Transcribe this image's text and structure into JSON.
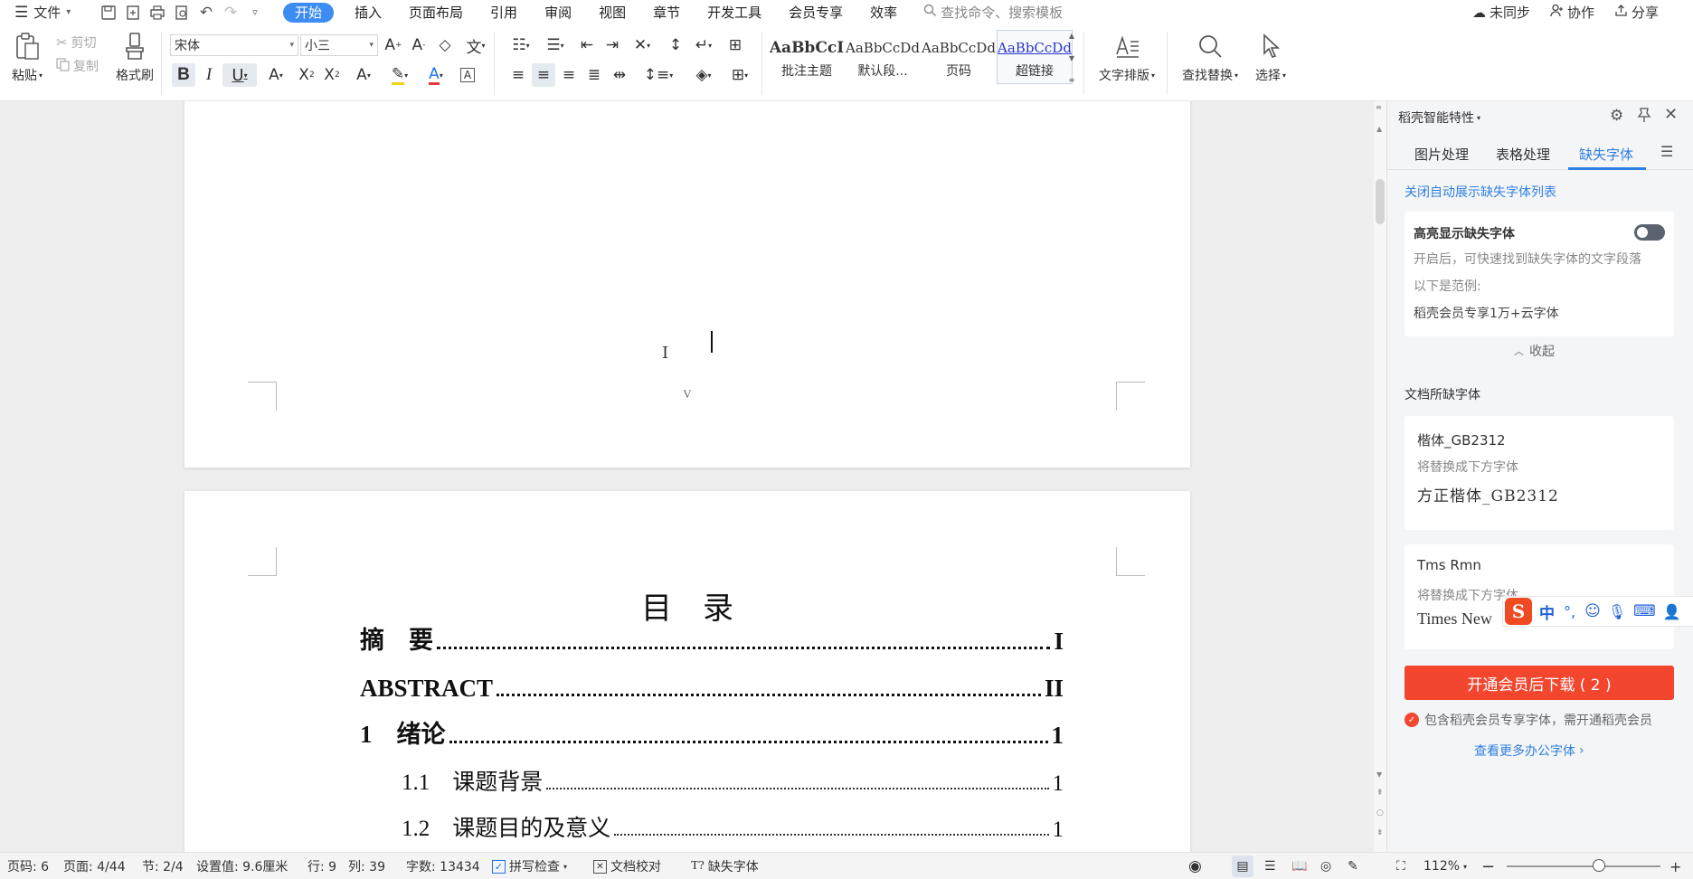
{
  "menubar": {
    "file_label": "文件",
    "tabs": [
      "开始",
      "插入",
      "页面布局",
      "引用",
      "审阅",
      "视图",
      "章节",
      "开发工具",
      "会员专享",
      "效率"
    ],
    "search_placeholder": "查找命令、搜索模板",
    "sync_label": "未同步",
    "collab_label": "协作",
    "share_label": "分享"
  },
  "ribbon": {
    "paste_label": "粘贴",
    "cut_label": "剪切",
    "copy_label": "复制",
    "format_painter_label": "格式刷",
    "font_name": "宋体",
    "font_size": "小三",
    "styles": [
      {
        "preview": "AaBbCcI",
        "label": "批注主题"
      },
      {
        "preview": "AaBbCcDd",
        "label": "默认段..."
      },
      {
        "preview": "AaBbCcDd",
        "label": "页码"
      },
      {
        "preview": "AaBbCcDd",
        "label": "超链接"
      }
    ],
    "text_layout_label": "文字排版",
    "find_replace_label": "查找替换",
    "select_label": "选择"
  },
  "document": {
    "page1_footer": "V",
    "toc_title": "目　录",
    "toc": [
      {
        "title": "摘　要",
        "page": "I",
        "level": 1
      },
      {
        "title": "ABSTRACT",
        "page": "II",
        "level": 1
      },
      {
        "title": "1　绪论",
        "page": "1",
        "level": 1
      },
      {
        "title": "1.1　课题背景",
        "page": "1",
        "level": 2
      },
      {
        "title": "1.2　课题目的及意义",
        "page": "1",
        "level": 2
      }
    ]
  },
  "panel": {
    "title": "稻壳智能特性",
    "tabs": [
      "图片处理",
      "表格处理",
      "缺失字体"
    ],
    "active_tab": 2,
    "close_auto_link": "关闭自动展示缺失字体列表",
    "highlight_title": "高亮显示缺失字体",
    "highlight_on": false,
    "highlight_desc": "开启后，可快速找到缺失字体的文字段落",
    "example_label": "以下是范例:",
    "example_text": "稻壳会员专享1万+云字体",
    "collapse_label": "收起",
    "missing_section_title": "文档所缺字体",
    "missing_fonts": [
      {
        "name": "楷体_GB2312",
        "replace_label": "将替换成下方字体",
        "replacement": "方正楷体_GB2312"
      },
      {
        "name": "Tms Rmn",
        "replace_label": "将替换成下方字体",
        "replacement": "Times New"
      }
    ],
    "ime_label": "中",
    "download_button": "开通会员后下载 ( 2 )",
    "member_note": "包含稻壳会员专享字体，需开通稻壳会员",
    "more_fonts_link": "查看更多办公字体"
  },
  "status": {
    "page_num": "页码: 6",
    "pages": "页面: 4/44",
    "section": "节: 2/4",
    "setting": "设置值: 9.6厘米",
    "row": "行: 9",
    "col": "列: 39",
    "word_count": "字数: 13434",
    "spell_check": "拼写检查",
    "proofread": "文档校对",
    "missing_font": "缺失字体",
    "zoom": "112%",
    "zoom_fraction": 0.6
  },
  "colors": {
    "accent": "#3d8cf4",
    "link": "#2f7fe0",
    "download_button": "#f2462f"
  }
}
